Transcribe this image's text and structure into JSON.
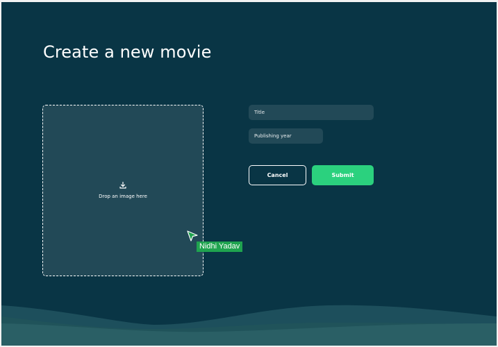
{
  "page": {
    "title": "Create a new movie"
  },
  "dropzone": {
    "label": "Drop an image here",
    "icon": "download-icon"
  },
  "form": {
    "title_placeholder": "Title",
    "title_value": "",
    "year_placeholder": "Publishing year",
    "year_value": ""
  },
  "buttons": {
    "cancel_label": "Cancel",
    "submit_label": "Submit"
  },
  "collaborator": {
    "name": "Nidhi Yadav",
    "cursor_icon": "pointer-cursor-icon"
  },
  "colors": {
    "background": "#093545",
    "input_bg": "#224957",
    "primary": "#2bd17e",
    "text": "#ffffff",
    "collaborator": "#1fa34f"
  }
}
